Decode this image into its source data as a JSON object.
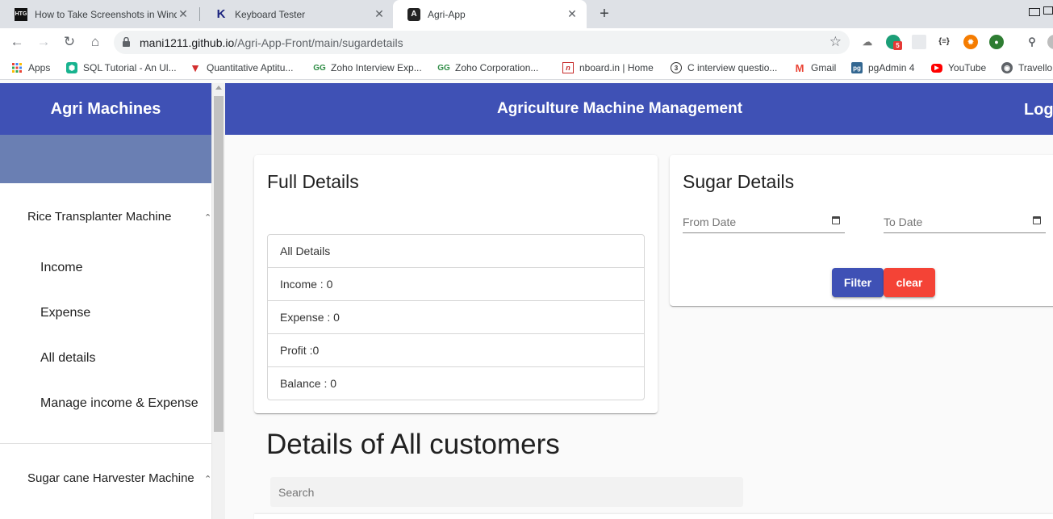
{
  "browser": {
    "tabs": [
      {
        "title": "How to Take Screenshots in Windo",
        "icon": "htg-favicon",
        "icon_text": "HTG"
      },
      {
        "title": "Keyboard Tester",
        "icon": "keyboard-tester-favicon",
        "icon_text": "K"
      },
      {
        "title": "Agri-App",
        "icon": "angular-favicon",
        "icon_text": "A"
      }
    ],
    "close_glyph": "✕",
    "new_tab_glyph": "+",
    "url_host": "mani1211.github.io",
    "url_path": "/Agri-App-Front/main/sugardetails",
    "extension_badge": "5",
    "bookmarks": [
      {
        "label": "Apps",
        "icon": "apps-grid-icon"
      },
      {
        "label": "SQL Tutorial - An Ul...",
        "icon": "sql-favicon"
      },
      {
        "label": "Quantitative Aptitu...",
        "icon": "indiabix-favicon"
      },
      {
        "label": "Zoho Interview Exp...",
        "icon": "gfg-favicon"
      },
      {
        "label": "Zoho Corporation...",
        "icon": "gfg-favicon"
      },
      {
        "label": "nboard.in | Home",
        "icon": "nboard-favicon"
      },
      {
        "label": "C interview questio...",
        "icon": "c-favicon"
      },
      {
        "label": "Gmail",
        "icon": "gmail-favicon"
      },
      {
        "label": "pgAdmin 4",
        "icon": "pgadmin-favicon"
      },
      {
        "label": "YouTube",
        "icon": "youtube-favicon"
      },
      {
        "label": "Travello",
        "icon": "globe-favicon"
      }
    ]
  },
  "app": {
    "brand": "Agri Machines",
    "header_title": "Agriculture Machine Management",
    "logout_label": "Logout",
    "sidebar": {
      "sections": [
        {
          "label": "Rice Transplanter Machine",
          "items": [
            "Income",
            "Expense",
            "All details",
            "Manage income & Expense"
          ]
        },
        {
          "label": "Sugar cane Harvester Machine",
          "items": []
        }
      ]
    },
    "full_details": {
      "title": "Full Details",
      "rows": [
        "All Details",
        "Income : 0",
        "Expense : 0",
        "Profit :0",
        "Balance : 0"
      ]
    },
    "sugar_details": {
      "title": "Sugar Details",
      "from_placeholder": "From Date",
      "to_placeholder": "To Date",
      "filter_label": "Filter",
      "clear_label": "clear"
    },
    "customers": {
      "title": "Details of All customers",
      "search_placeholder": "Search"
    }
  },
  "colors": {
    "primary": "#3f51b5",
    "accent_warn": "#f44336",
    "sidebar_band": "#6a7fb3"
  }
}
